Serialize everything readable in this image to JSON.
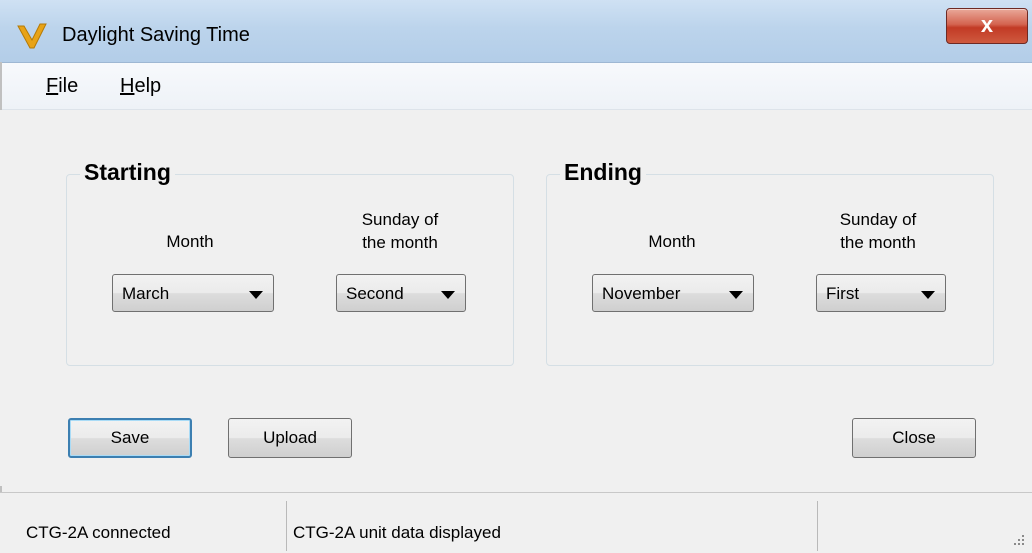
{
  "window": {
    "title": "Daylight Saving Time",
    "close_label": "x"
  },
  "menu": {
    "file": {
      "mnemonic": "F",
      "rest": "ile"
    },
    "help": {
      "mnemonic": "H",
      "rest": "elp"
    }
  },
  "starting": {
    "title": "Starting",
    "month_label": "Month",
    "sunday_label_line1": "Sunday of",
    "sunday_label_line2": "the month",
    "month_value": "March",
    "sunday_value": "Second"
  },
  "ending": {
    "title": "Ending",
    "month_label": "Month",
    "sunday_label_line1": "Sunday of",
    "sunday_label_line2": "the month",
    "month_value": "November",
    "sunday_value": "First"
  },
  "buttons": {
    "save": "Save",
    "upload": "Upload",
    "close": "Close"
  },
  "status": {
    "connection": "CTG-2A connected",
    "message": "CTG-2A unit data displayed",
    "extra": ""
  },
  "colors": {
    "title_bar": "#bcd4ec",
    "close_button": "#c23a25",
    "default_button_border": "#3c7fb1"
  }
}
